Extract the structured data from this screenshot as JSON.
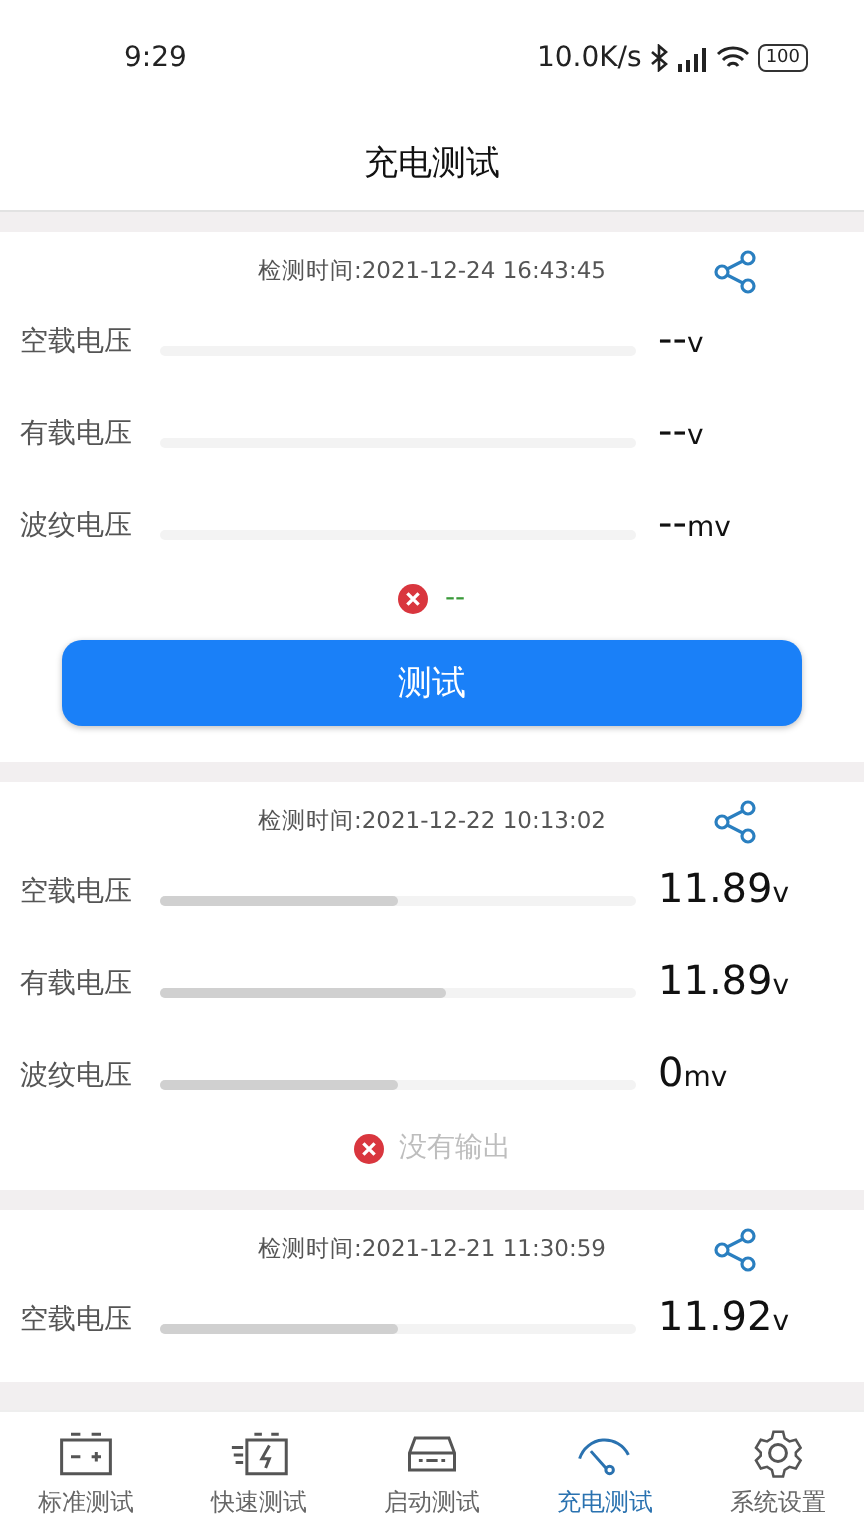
{
  "status_bar": {
    "time": "9:29",
    "speed": "10.0K/s",
    "battery": "100"
  },
  "header": {
    "title": "充电测试"
  },
  "records": [
    {
      "time": "检测时间:2021-12-24 16:43:45",
      "rows": [
        {
          "label": "空载电压",
          "level": 0,
          "value": "--",
          "unit": "v"
        },
        {
          "label": "有载电压",
          "level": 0,
          "value": "--",
          "unit": "v"
        },
        {
          "label": "波纹电压",
          "level": 0,
          "value": "--",
          "unit": "mv"
        }
      ],
      "result": {
        "text": "--",
        "color": "#3a9a3a"
      },
      "button": "测试"
    },
    {
      "time": "检测时间:2021-12-22 10:13:02",
      "rows": [
        {
          "label": "空载电压",
          "level": 0.5,
          "value": "11.89",
          "unit": "v"
        },
        {
          "label": "有载电压",
          "level": 0.6,
          "value": "11.89",
          "unit": "v"
        },
        {
          "label": "波纹电压",
          "level": 0.5,
          "value": "0",
          "unit": "mv"
        }
      ],
      "result": {
        "text": "没有输出",
        "color": "#bdbdbd"
      }
    },
    {
      "time": "检测时间:2021-12-21 11:30:59",
      "rows": [
        {
          "label": "空载电压",
          "level": 0.5,
          "value": "11.92",
          "unit": "v"
        }
      ]
    }
  ],
  "tabs": [
    {
      "label": "标准测试",
      "kind": "battery",
      "selected": false
    },
    {
      "label": "快速测试",
      "kind": "fast",
      "selected": false
    },
    {
      "label": "启动测试",
      "kind": "car",
      "selected": false
    },
    {
      "label": "充电测试",
      "kind": "gauge",
      "selected": true
    },
    {
      "label": "系统设置",
      "kind": "gear",
      "selected": false
    }
  ]
}
